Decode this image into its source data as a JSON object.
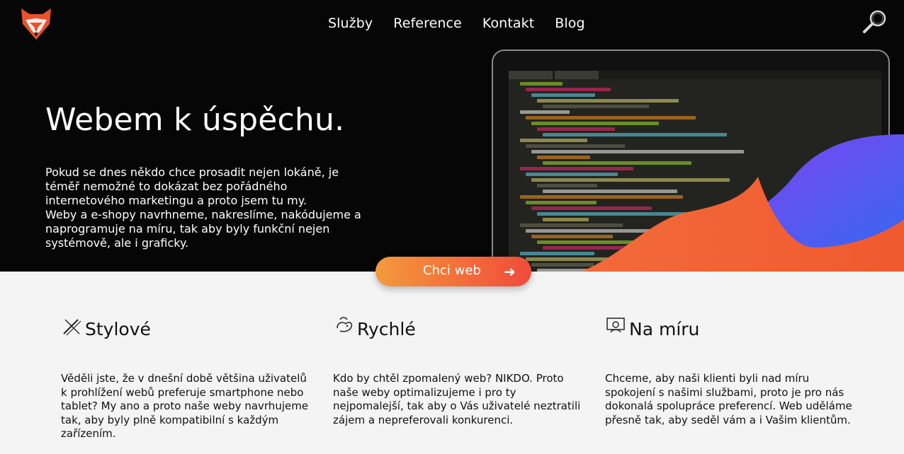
{
  "colors": {
    "accent_start": "#f39a3c",
    "accent_end": "#ef4b3a",
    "logo_orange": "#e9522b",
    "wave_purple": "#8b3df2",
    "wave_blue": "#2f6bf0"
  },
  "header": {
    "logo_icon": "fox-logo-icon",
    "nav": [
      "Služby",
      "Reference",
      "Kontakt",
      "Blog"
    ],
    "search_icon": "magnifier-icon"
  },
  "hero": {
    "title": "Webem k úspěchu.",
    "text": [
      "Pokud se dnes někdo chce prosadit nejen lokáně, je téměř nemožné to dokázat bez pořádného internetového marketingu a proto jsem tu my.",
      "Weby a e-shopy navrhneme, nakreslíme, nakódujeme a naprogramuje na míru, tak aby byly funkční nejen systémově, ale i graficky."
    ],
    "cta_label": "Chci web",
    "cta_icon": "arrow-right-icon"
  },
  "features": [
    {
      "icon": "pencil-ruler-icon",
      "title": "Stylové",
      "text": "Věděli jste, že v dnešní době většina uživatelů k prohlížení webů preferuje smartphone nebo tablet? My ano a proto naše weby navrhujeme tak, aby byly plně kompatibilní s každým zařízením."
    },
    {
      "icon": "rabbit-icon",
      "title": "Rychlé",
      "text": "Kdo by chtěl zpomalený web? NIKDO. Proto naše weby optimalizujeme i pro ty nejpomalejší, tak aby o Vás uživatelé neztratili zájem a nepreferovali konkurenci."
    },
    {
      "icon": "presenter-icon",
      "title": "Na míru",
      "text": "Chceme, aby naši klienti byli nad míru spokojení s našimi službami, proto je pro nás dokonalá spolupráce preferencí. Web uděláme přesně tak, aby seděl vám a i Vašim klientům."
    }
  ]
}
